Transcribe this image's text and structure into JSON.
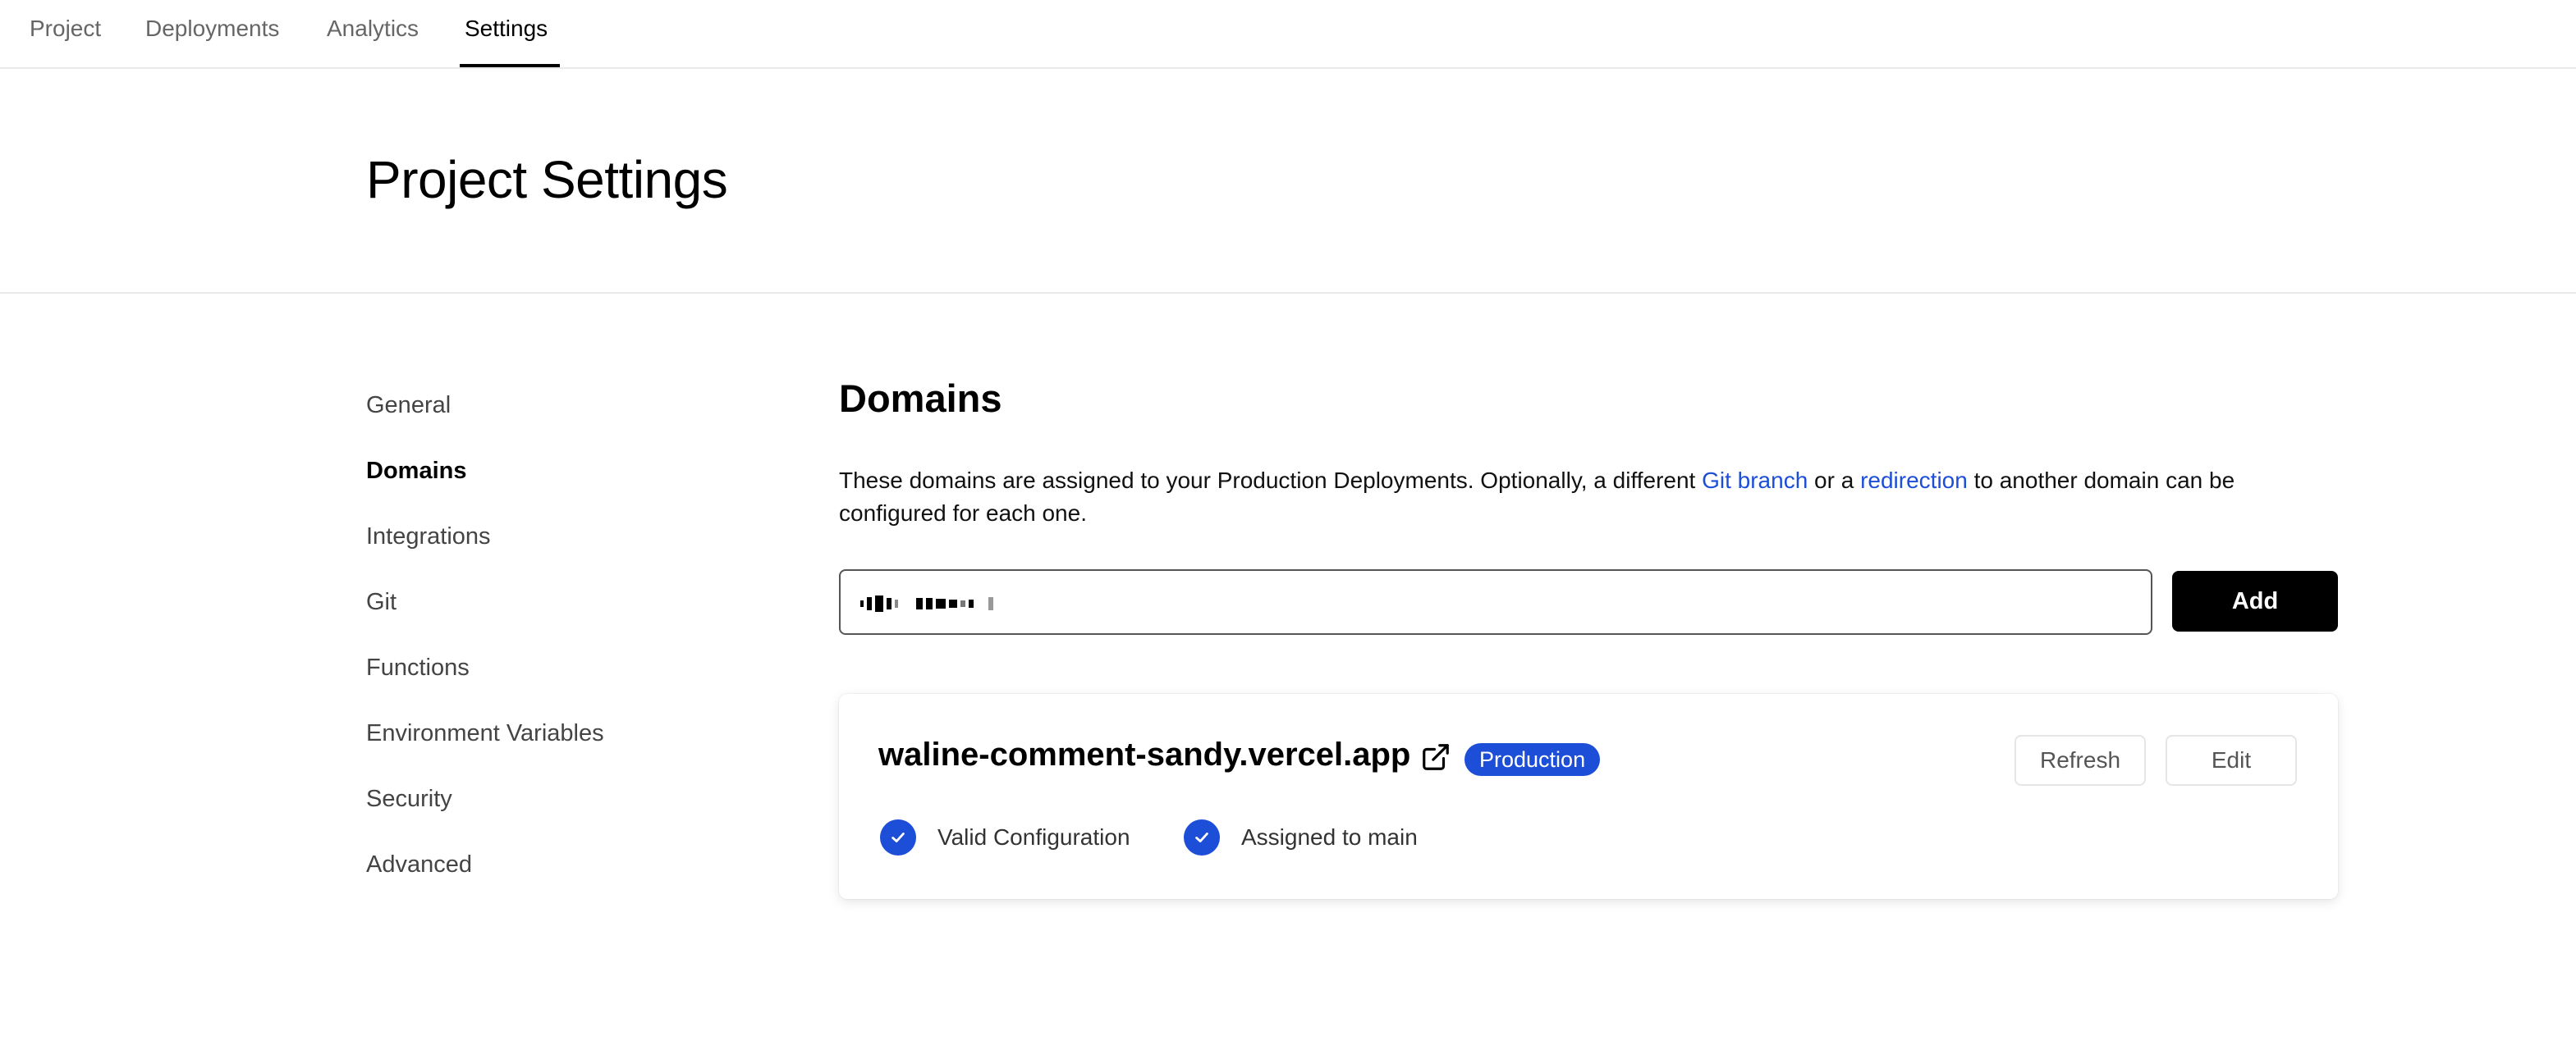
{
  "topnav": {
    "tabs": [
      {
        "label": "Project"
      },
      {
        "label": "Deployments"
      },
      {
        "label": "Analytics"
      },
      {
        "label": "Settings",
        "active": true
      }
    ]
  },
  "header": {
    "title": "Project Settings"
  },
  "sidebar": {
    "items": [
      {
        "label": "General"
      },
      {
        "label": "Domains",
        "active": true
      },
      {
        "label": "Integrations"
      },
      {
        "label": "Git"
      },
      {
        "label": "Functions"
      },
      {
        "label": "Environment Variables"
      },
      {
        "label": "Security"
      },
      {
        "label": "Advanced"
      }
    ]
  },
  "domains": {
    "title": "Domains",
    "description": {
      "part1": "These domains are assigned to your Production Deployments. Optionally, a different ",
      "link1": "Git branch",
      "part2": " or a ",
      "link2": "redirection",
      "part3": " to another domain can be configured for each one."
    },
    "add_button": "Add",
    "list": [
      {
        "domain": "waline-comment-sandy.vercel.app",
        "badge": "Production",
        "refresh_label": "Refresh",
        "edit_label": "Edit",
        "status": [
          {
            "label": "Valid Configuration"
          },
          {
            "label": "Assigned to main"
          }
        ]
      }
    ]
  },
  "colors": {
    "accent": "#1d4ed8",
    "text": "#000000",
    "muted": "#666666",
    "border": "#eaeaea"
  },
  "icons": {
    "external_link": "external-link-icon",
    "check": "check-circle-icon"
  }
}
